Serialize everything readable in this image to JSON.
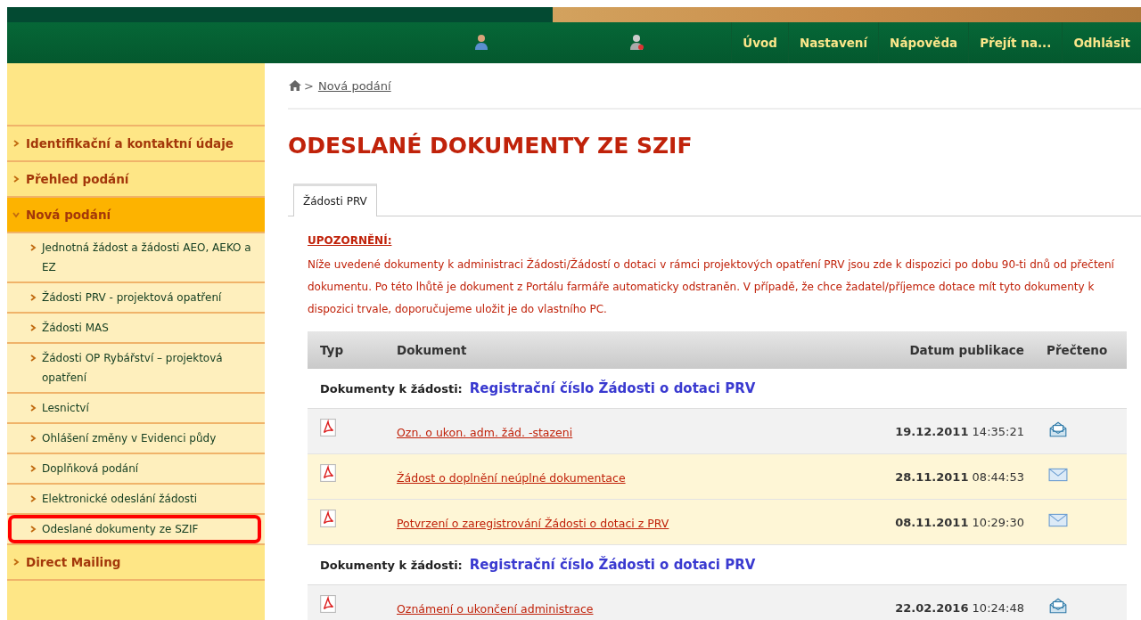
{
  "top_nav": {
    "items": [
      "Úvod",
      "Nastavení",
      "Nápověda",
      "Přejít na...",
      "Odhlásit"
    ]
  },
  "sidebar": {
    "items": [
      {
        "label": "Identifikační a kontaktní údaje",
        "expanded": false
      },
      {
        "label": "Přehled podání",
        "expanded": false
      },
      {
        "label": "Nová podání",
        "expanded": true,
        "children": [
          {
            "label": "Jednotná žádost a žádosti AEO, AEKO a EZ",
            "selected": false
          },
          {
            "label": "Žádosti PRV - projektová opatření",
            "selected": false
          },
          {
            "label": "Žádosti MAS",
            "selected": false
          },
          {
            "label": "Žádosti OP Rybářství – projektová opatření",
            "selected": false
          },
          {
            "label": "Lesnictví",
            "selected": false
          },
          {
            "label": "Ohlášení změny v Evidenci půdy",
            "selected": false
          },
          {
            "label": "Doplňková podání",
            "selected": false
          },
          {
            "label": "Elektronické odeslání žádosti",
            "selected": false
          },
          {
            "label": "Odeslané dokumenty ze SZIF",
            "selected": true
          }
        ]
      },
      {
        "label": "Direct Mailing",
        "expanded": false
      }
    ]
  },
  "breadcrumb": {
    "separator": ">",
    "items": [
      "Nová podání"
    ]
  },
  "title": "ODESLANÉ DOKUMENTY ZE SZIF",
  "tabs": [
    {
      "label": "Žádosti PRV",
      "selected": true
    }
  ],
  "warning": {
    "heading": "UPOZORNĚNÍ:",
    "text": "Níže uvedené dokumenty k administraci Žádosti/Žádostí o dotaci v rámci projektových opatření PRV jsou zde k dispozici po dobu 90-ti dnů od přečtení dokumentu. Po této lhůtě je dokument z Portálu farmáře automaticky odstraněn. V případě, že chce žadatel/příjemce dotace mít tyto dokumenty k dispozici trvale, doporučujeme uložit je do vlastního PC."
  },
  "table": {
    "columns": [
      "Typ",
      "Dokument",
      "Datum publikace",
      "Přečteno"
    ],
    "groups": [
      {
        "label": "Dokumenty k žádosti:",
        "link": "Registrační číslo Žádosti o dotaci PRV",
        "rows": [
          {
            "document": "Ozn. o ukon. adm. žád. -stazeni",
            "date": "19.12.2011",
            "time": "14:35:21",
            "read": true
          },
          {
            "document": "Žádost o doplnění neúplné dokumentace",
            "date": "28.11.2011",
            "time": "08:44:53",
            "read": false
          },
          {
            "document": "Potvrzení o zaregistrování Žádosti o dotaci z PRV",
            "date": "08.11.2011",
            "time": "10:29:30",
            "read": false
          }
        ]
      },
      {
        "label": "Dokumenty k žádosti:",
        "link": "Registrační číslo Žádosti o dotaci PRV",
        "rows": [
          {
            "document": "Oznámení o ukončení administrace",
            "date": "22.02.2016",
            "time": "10:24:48",
            "read": true
          }
        ]
      }
    ]
  }
}
